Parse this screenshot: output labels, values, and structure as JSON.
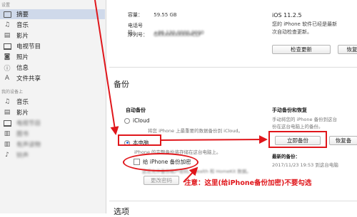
{
  "sidebar": {
    "section_settings": "设置",
    "items_settings": [
      {
        "label": "摘要",
        "icon": "summary-icon"
      },
      {
        "label": "音乐",
        "icon": "music-note-icon"
      },
      {
        "label": "影片",
        "icon": "film-icon"
      },
      {
        "label": "电视节目",
        "icon": "tv-icon"
      },
      {
        "label": "照片",
        "icon": "camera-icon"
      },
      {
        "label": "信息",
        "icon": "info-icon"
      },
      {
        "label": "文件共享",
        "icon": "app-store-icon"
      }
    ],
    "section_device": "我的设备上",
    "items_device": [
      {
        "label": "音乐",
        "icon": "music-note-icon"
      },
      {
        "label": "影片",
        "icon": "film-icon"
      },
      {
        "label": "电视节目",
        "icon": "tv-icon"
      },
      {
        "label": "图书",
        "icon": "book-icon"
      },
      {
        "label": "有声读物",
        "icon": "audiobook-icon"
      },
      {
        "label": "铃声",
        "icon": "bell-icon"
      }
    ]
  },
  "device_info": {
    "capacity_label": "容量：",
    "capacity_value": "59.55 GB",
    "phone_label": "电话号码：",
    "phone_value": "+86 130 0000 0000",
    "serial_label": "序列号：",
    "serial_value": "GXXXXXXXXXHCLF"
  },
  "ios": {
    "version": "iOS 11.2.5",
    "description": "您的 iPhone 软件已经是最新版本。iTunes 将于 2018/2/18 再次自动检查更新。",
    "desc_line1": "您的 iPhone 软件已经是最新",
    "desc_line2": "次自动检查更新。",
    "check_update_button": "检查更新",
    "restore_button": "恢复"
  },
  "backup": {
    "section_title": "备份",
    "auto_title": "自动备份",
    "icloud_label": "iCloud",
    "icloud_desc": "将您 iPhone 上最重要的数据备份到 iCloud。",
    "this_computer_label": "本电脑",
    "this_computer_desc": "iPhone 的完整备份将存储在这台电脑上。",
    "encrypt_label": "给 iPhone 备份加密",
    "encrypt_desc": "这还允许备份帐户密码、Health 和 HomeKit 数据。",
    "change_password_button": "更改密码",
    "manual_title": "手动备份和恢复",
    "manual_desc1": "手动将您的 iPhone 备份到这台",
    "manual_desc2": "份在这台电脑上的备份。",
    "backup_now_button": "立即备份",
    "restore_backup_button": "恢复备",
    "latest_backup_label": "最新的备份：",
    "latest_backup_value": "2017/11/23 19:53 到这台电脑"
  },
  "annotation": {
    "note": "注意：这里(给iPhone备份加密)不要勾选",
    "color": "#e0161b"
  },
  "options": {
    "section_title": "选项"
  }
}
